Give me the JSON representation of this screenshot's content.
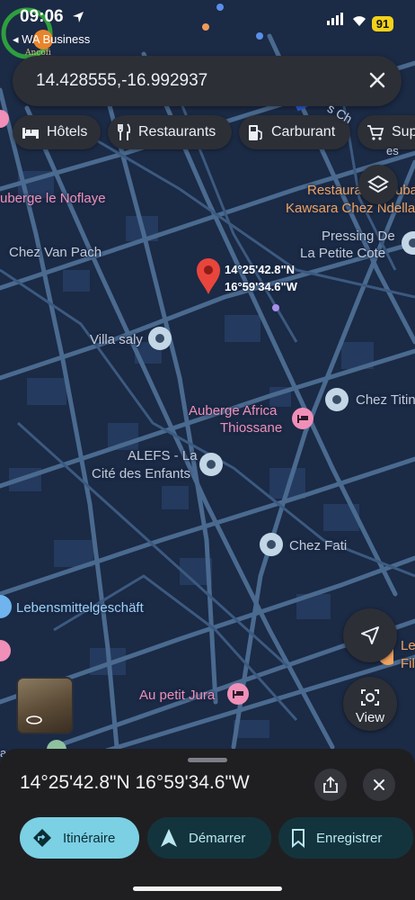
{
  "status_bar": {
    "time": "09:06",
    "back_app": "WA Business",
    "logo_text": "Ancofi",
    "battery": "91"
  },
  "search": {
    "value": "14.428555,-16.992937",
    "close_icon": "close-icon"
  },
  "chips": [
    {
      "label": "Hôtels",
      "icon": "bed-icon"
    },
    {
      "label": "Restaurants",
      "icon": "fork-knife-icon"
    },
    {
      "label": "Carburant",
      "icon": "fuel-pump-icon"
    },
    {
      "label": "Sup",
      "icon": "cart-icon"
    }
  ],
  "map": {
    "pin_coords": [
      "14°25'42.8\"N",
      "16°59'34.6\"W"
    ],
    "places": {
      "auberge_noflaye": "uberge le Noflaye",
      "chez_van_pach": "Chez Van Pach",
      "restaurant_kawsara_1": "Restaura",
      "restaurant_kawsara_1b": "uba",
      "restaurant_kawsara_2": "Kawsara Chez Ndella",
      "pressing_1": "Pressing De",
      "pressing_2": "La Petite Cote",
      "villa_saly": "Villa saly",
      "chez_titi": "Chez Titin",
      "auberge_africa_1": "Auberge Africa",
      "auberge_africa_2": "Thiossane",
      "alefs_1": "ALEFS - La",
      "alefs_2": "Cité des Enfants",
      "chez_fati": "Chez Fati",
      "lebensmittel": "Lebensmittelgeschäft",
      "au_petit_jura": "Au petit Jura",
      "le_fi_1": "Le",
      "le_fi_2": "Fil",
      "street_fragment": "s Ch",
      "street_fragment_2": "es",
      "edge_label": "a"
    }
  },
  "buttons": {
    "view": "View"
  },
  "sheet": {
    "title": "14°25'42.8\"N 16°59'34.6\"W",
    "actions": [
      {
        "label": "Itinéraire",
        "icon": "directions-icon"
      },
      {
        "label": "Démarrer",
        "icon": "navigation-arrow-icon"
      },
      {
        "label": "Enregistrer",
        "icon": "bookmark-icon"
      }
    ]
  },
  "colors": {
    "map_bg": "#1b2a45",
    "road": "#4a6a8f",
    "pin": "#e8453c",
    "primary_button": "#7bd0e4"
  }
}
